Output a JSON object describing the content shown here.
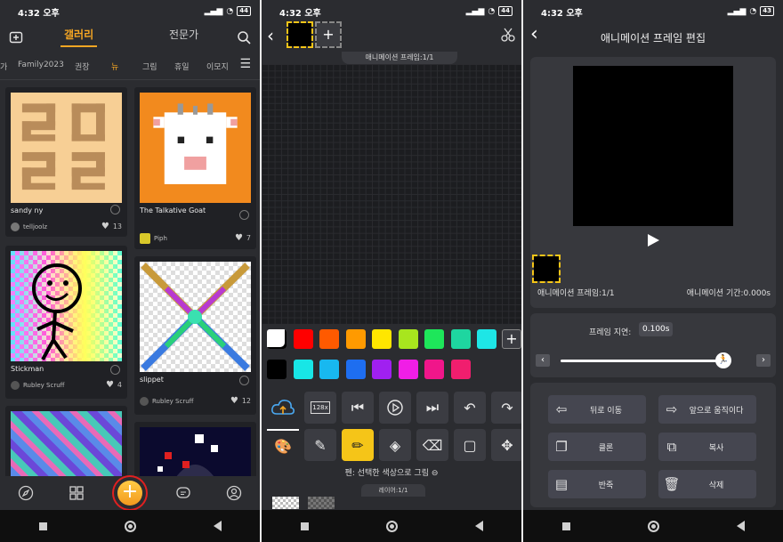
{
  "status": {
    "time": "4:32 오후",
    "battery": "44",
    "battery3": "43"
  },
  "gallery": {
    "tabs": [
      "갤러리",
      "전문가"
    ],
    "categories": [
      "가",
      "Family2023",
      "권장",
      "뉴",
      "그림",
      "휴일",
      "이모지"
    ],
    "cards": [
      {
        "title": "sandy ny",
        "user": "telljoolz",
        "likes": "13"
      },
      {
        "title": "The Talkative Goat",
        "user": "Piph",
        "likes": "7"
      },
      {
        "title": "Stickman",
        "user": "Rubley Scruff",
        "likes": "4"
      },
      {
        "title": "slippet",
        "user": "Rubley Scruff",
        "likes": "12"
      }
    ]
  },
  "editor": {
    "frame_label": "애니메이션 프레임:1/1",
    "hint": "펜: 선택한 색상으로 그림",
    "layer_label": "레이어:1/1",
    "size_badge": "128x",
    "palette_colors": [
      "#ffffff",
      "#ff0000",
      "#ff5a00",
      "#ff9a00",
      "#ffe600",
      "#a8e51e",
      "#1ee65a",
      "#1ed6a0",
      "#1ee6e6",
      "#000000",
      "#18e6e6",
      "#18b8f0",
      "#1e6ef0",
      "#a020f0",
      "#f01ee6",
      "#f0168a",
      "#f01e6e"
    ]
  },
  "anim": {
    "title": "애니메이션 프레임 편집",
    "frame_label": "애니메이션 프레임:1/1",
    "duration_label": "애니메이션 기간:0.000s",
    "delay_label": "프레임 지연:",
    "delay_value": "0.100s",
    "buttons": [
      "뒤로 이동",
      "앞으로 움직이다",
      "클론",
      "복사",
      "반죽",
      "삭제"
    ]
  }
}
